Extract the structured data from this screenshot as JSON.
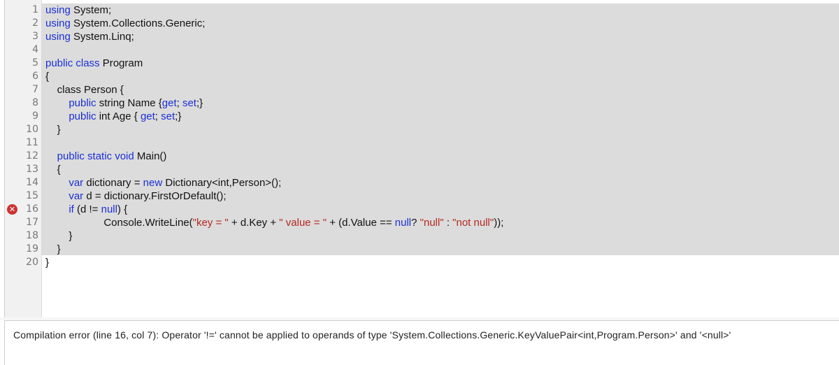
{
  "editor": {
    "error_line": 16,
    "error_marker_symbol": "✕",
    "lines": [
      {
        "n": "1",
        "tokens": [
          {
            "t": "using",
            "c": "kw"
          },
          {
            "t": " System;",
            "c": ""
          }
        ]
      },
      {
        "n": "2",
        "tokens": [
          {
            "t": "using",
            "c": "kw"
          },
          {
            "t": " System.Collections.Generic;",
            "c": ""
          }
        ]
      },
      {
        "n": "3",
        "tokens": [
          {
            "t": "using",
            "c": "kw"
          },
          {
            "t": " System.Linq;",
            "c": ""
          }
        ]
      },
      {
        "n": "4",
        "tokens": []
      },
      {
        "n": "5",
        "tokens": [
          {
            "t": "public class",
            "c": "kw"
          },
          {
            "t": " Program",
            "c": ""
          }
        ]
      },
      {
        "n": "6",
        "tokens": [
          {
            "t": "{",
            "c": ""
          }
        ]
      },
      {
        "n": "7",
        "tokens": [
          {
            "t": "    class Person {",
            "c": ""
          }
        ]
      },
      {
        "n": "8",
        "tokens": [
          {
            "t": "        ",
            "c": ""
          },
          {
            "t": "public",
            "c": "kw"
          },
          {
            "t": " string Name {",
            "c": ""
          },
          {
            "t": "get",
            "c": "kw"
          },
          {
            "t": "; ",
            "c": ""
          },
          {
            "t": "set",
            "c": "kw"
          },
          {
            "t": ";}",
            "c": ""
          }
        ]
      },
      {
        "n": "9",
        "tokens": [
          {
            "t": "        ",
            "c": ""
          },
          {
            "t": "public",
            "c": "kw"
          },
          {
            "t": " int Age { ",
            "c": ""
          },
          {
            "t": "get",
            "c": "kw"
          },
          {
            "t": "; ",
            "c": ""
          },
          {
            "t": "set",
            "c": "kw"
          },
          {
            "t": ";}",
            "c": ""
          }
        ]
      },
      {
        "n": "10",
        "tokens": [
          {
            "t": "    }",
            "c": ""
          }
        ]
      },
      {
        "n": "11",
        "tokens": []
      },
      {
        "n": "12",
        "tokens": [
          {
            "t": "    ",
            "c": ""
          },
          {
            "t": "public static void",
            "c": "kw"
          },
          {
            "t": " Main()",
            "c": ""
          }
        ]
      },
      {
        "n": "13",
        "tokens": [
          {
            "t": "    {",
            "c": ""
          }
        ]
      },
      {
        "n": "14",
        "tokens": [
          {
            "t": "        ",
            "c": ""
          },
          {
            "t": "var",
            "c": "kw"
          },
          {
            "t": " dictionary = ",
            "c": ""
          },
          {
            "t": "new",
            "c": "kw"
          },
          {
            "t": " Dictionary<int,Person>();",
            "c": ""
          }
        ]
      },
      {
        "n": "15",
        "tokens": [
          {
            "t": "        ",
            "c": ""
          },
          {
            "t": "var",
            "c": "kw"
          },
          {
            "t": " d = dictionary.FirstOrDefault();",
            "c": ""
          }
        ]
      },
      {
        "n": "16",
        "tokens": [
          {
            "t": "        ",
            "c": ""
          },
          {
            "t": "if",
            "c": "kw"
          },
          {
            "t": " (d != ",
            "c": ""
          },
          {
            "t": "null",
            "c": "kw"
          },
          {
            "t": ") {",
            "c": ""
          }
        ]
      },
      {
        "n": "17",
        "tokens": [
          {
            "t": "                    Console.WriteLine(",
            "c": ""
          },
          {
            "t": "\"key = \"",
            "c": "str"
          },
          {
            "t": " + d.Key + ",
            "c": ""
          },
          {
            "t": "\" value = \"",
            "c": "str"
          },
          {
            "t": " + (d.Value == ",
            "c": ""
          },
          {
            "t": "null",
            "c": "kw"
          },
          {
            "t": "? ",
            "c": ""
          },
          {
            "t": "\"null\"",
            "c": "str"
          },
          {
            "t": " : ",
            "c": ""
          },
          {
            "t": "\"not null\"",
            "c": "str"
          },
          {
            "t": "));",
            "c": ""
          }
        ]
      },
      {
        "n": "18",
        "tokens": [
          {
            "t": "        }",
            "c": ""
          }
        ]
      },
      {
        "n": "19",
        "tokens": [
          {
            "t": "    }",
            "c": ""
          }
        ]
      },
      {
        "n": "20",
        "tokens": [
          {
            "t": "}",
            "c": ""
          }
        ]
      }
    ]
  },
  "output": {
    "message": "Compilation error (line 16, col 7): Operator '!=' cannot be applied to operands of type 'System.Collections.Generic.KeyValuePair<int,Program.Person>' and '<null>'"
  },
  "colors": {
    "keyword": "#1a2fd6",
    "string": "#b5281f",
    "selection": "#dcdcdc",
    "error": "#cc3333"
  }
}
